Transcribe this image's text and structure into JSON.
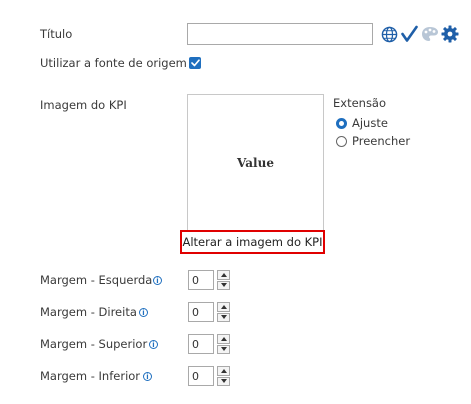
{
  "title_field": {
    "label": "Título",
    "value": ""
  },
  "source_font": {
    "label": "Utilizar a fonte de origem",
    "checked": true
  },
  "kpi_image": {
    "label": "Imagem do KPI",
    "preview_text": "Value",
    "change_link": "Alterar a imagem do KPI"
  },
  "extension": {
    "label": "Extensão",
    "options": [
      {
        "label": "Ajuste",
        "selected": true
      },
      {
        "label": "Preencher",
        "selected": false
      }
    ]
  },
  "margins": [
    {
      "label": "Margem - Esquerda",
      "value": "0"
    },
    {
      "label": "Margem - Direita",
      "value": "0"
    },
    {
      "label": "Margem - Superior",
      "value": "0"
    },
    {
      "label": "Margem - Inferior",
      "value": "0"
    }
  ],
  "icons": [
    "globe-icon",
    "checkmark-icon",
    "palette-icon",
    "gear-icon"
  ],
  "colors": {
    "accent": "#1f6fbf",
    "highlight_border": "#e00000"
  }
}
